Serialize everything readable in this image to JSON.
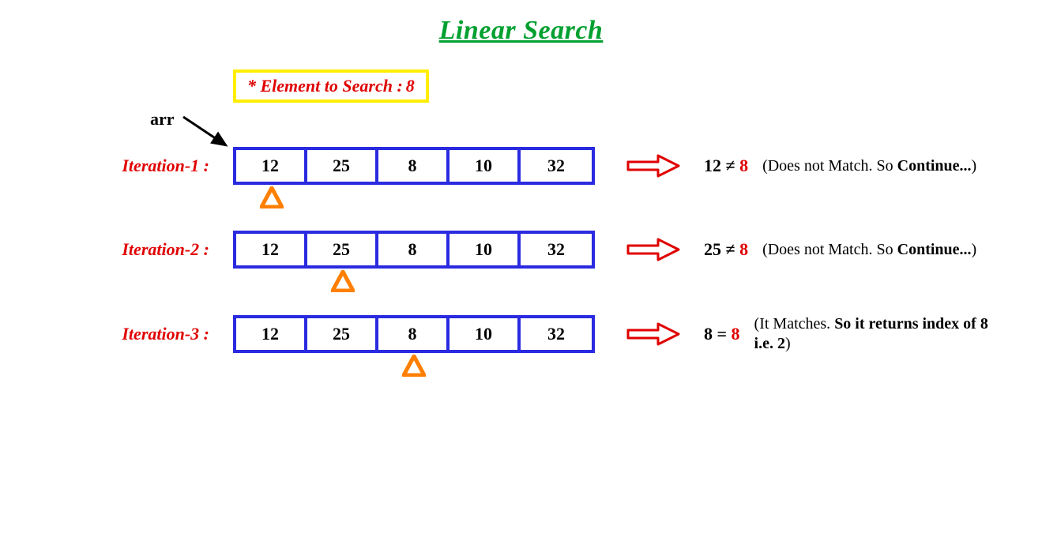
{
  "title": "Linear Search",
  "search_label": "* Element to Search :",
  "search_value": "8",
  "arr_label": "arr",
  "array_values": [
    "12",
    "25",
    "8",
    "10",
    "32"
  ],
  "iterations": [
    {
      "label": "Iteration-1 :",
      "pointer_index": 0,
      "compare_left": "12",
      "compare_op": "≠",
      "compare_right": "8",
      "note_pre": "(Does not Match. So ",
      "note_bold": "Continue...",
      "note_post": ")"
    },
    {
      "label": "Iteration-2 :",
      "pointer_index": 1,
      "compare_left": "25",
      "compare_op": "≠",
      "compare_right": "8",
      "note_pre": "(Does not Match. So ",
      "note_bold": "Continue...",
      "note_post": ")"
    },
    {
      "label": "Iteration-3 :",
      "pointer_index": 2,
      "compare_left": "8",
      "compare_op": "=",
      "compare_right": "8",
      "note_pre": "(It Matches. ",
      "note_bold": "So it returns index of  8 i.e. 2",
      "note_post": ")"
    }
  ]
}
